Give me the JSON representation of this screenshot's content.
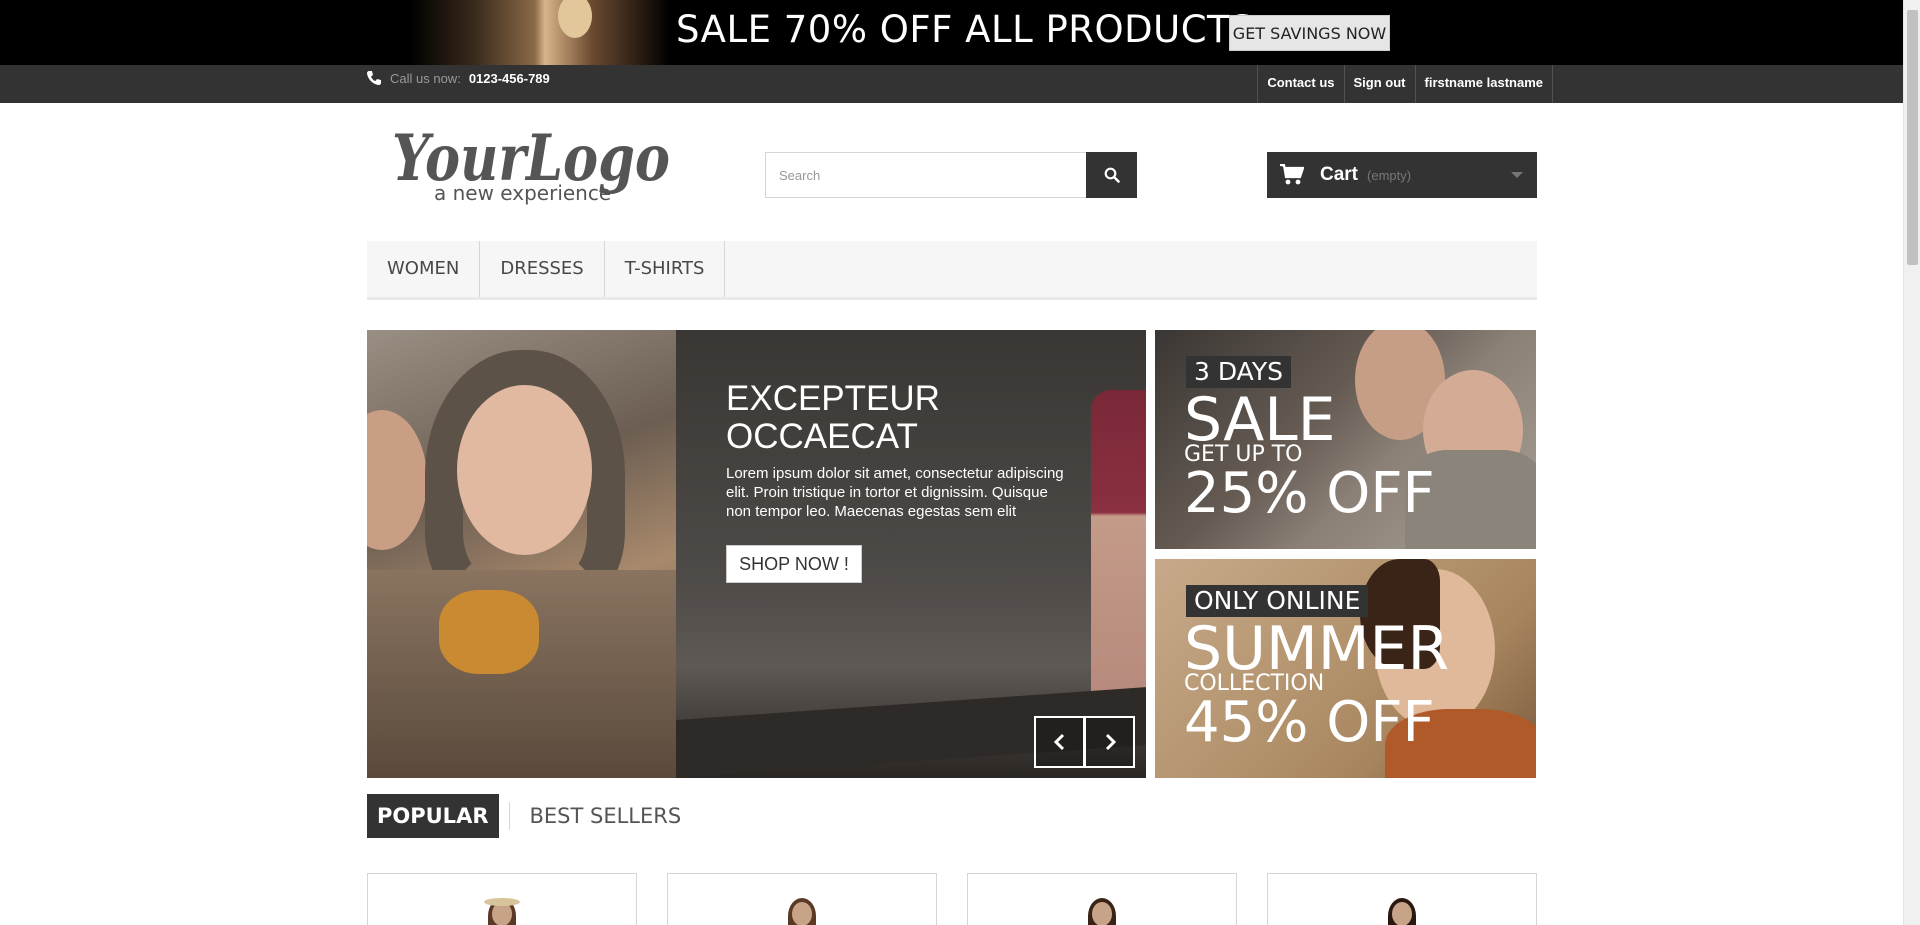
{
  "promo": {
    "headline": "SALE 70% OFF ALL PRODUCTS",
    "button": "GET SAVINGS NOW"
  },
  "topbar": {
    "call_label": "Call us now:",
    "phone": "0123-456-789",
    "links": [
      "Contact us",
      "Sign out",
      "firstname lastname"
    ]
  },
  "header": {
    "logo_text": "YourLogo",
    "logo_tagline": "a new experience",
    "search_placeholder": "Search",
    "cart_label": "Cart",
    "cart_status": "(empty)"
  },
  "menu": [
    "WOMEN",
    "DRESSES",
    "T-SHIRTS"
  ],
  "slider": {
    "title": "EXCEPTEUR OCCAECAT",
    "text": "Lorem ipsum dolor sit amet, consectetur adipiscing elit. Proin tristique in tortor et dignissim. Quisque non tempor leo. Maecenas egestas sem elit",
    "button": "SHOP NOW !"
  },
  "banners": [
    {
      "tag": "3 DAYS",
      "big": "SALE",
      "small": "GET UP TO",
      "off": "25% OFF"
    },
    {
      "tag": "ONLY ONLINE",
      "big": "SUMMER",
      "small": "COLLECTION",
      "off": "45% OFF"
    }
  ],
  "tabs": [
    "POPULAR",
    "BEST SELLERS"
  ],
  "colors": {
    "dark": "#333333",
    "light_bar": "#f6f6f6",
    "border": "#d6d4d4"
  },
  "icons": {
    "phone": "phone-icon",
    "search": "search-icon",
    "cart": "cart-icon",
    "prev": "chevron-left-icon",
    "next": "chevron-right-icon"
  }
}
